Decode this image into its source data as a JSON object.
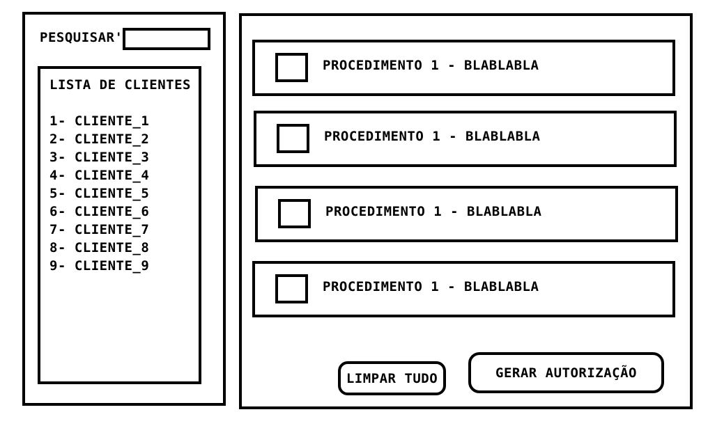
{
  "search": {
    "label": "PESQUISAR'",
    "value": "",
    "placeholder": ""
  },
  "client_list": {
    "title": "LISTA DE CLIENTES",
    "items": [
      "1- CLIENTE_1",
      "2- CLIENTE_2",
      "3- CLIENTE_3",
      "4- CLIENTE_4",
      "5- CLIENTE_5",
      "6- CLIENTE_6",
      "7- CLIENTE_7",
      "8- CLIENTE_8",
      "9- CLIENTE_9"
    ]
  },
  "procedures": [
    {
      "label": "PROCEDIMENTO 1 - BLABLABLA",
      "checked": false
    },
    {
      "label": "PROCEDIMENTO 1 - BLABLABLA",
      "checked": false
    },
    {
      "label": "PROCEDIMENTO 1 - BLABLABLA",
      "checked": false
    },
    {
      "label": "PROCEDIMENTO 1 - BLABLABLA",
      "checked": false
    }
  ],
  "actions": {
    "clear_label": "LIMPAR TUDO",
    "generate_label": "GERAR AUTORIZAÇÃO"
  },
  "colors": {
    "stroke": "#000000",
    "background": "#ffffff"
  }
}
